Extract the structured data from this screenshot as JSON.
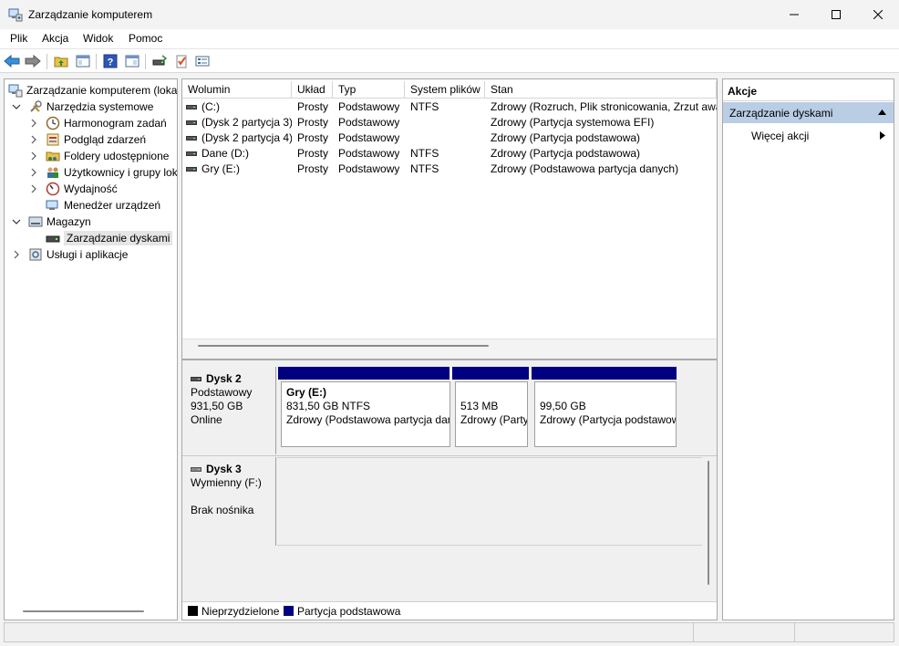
{
  "window": {
    "title": "Zarządzanie komputerem"
  },
  "menu": [
    {
      "label": "Plik"
    },
    {
      "label": "Akcja"
    },
    {
      "label": "Widok"
    },
    {
      "label": "Pomoc"
    }
  ],
  "tree": {
    "root": "Zarządzanie komputerem (lokalny)",
    "system_tools": "Narzędzia systemowe",
    "task_scheduler": "Harmonogram zadań",
    "event_viewer": "Podgląd zdarzeń",
    "shared_folders": "Foldery udostępnione",
    "users_groups": "Użytkownicy i grupy lokalne",
    "performance": "Wydajność",
    "device_manager": "Menedżer urządzeń",
    "storage": "Magazyn",
    "disk_management": "Zarządzanie dyskami",
    "services_apps": "Usługi i aplikacje"
  },
  "volumes": {
    "columns": [
      "Wolumin",
      "Układ",
      "Typ",
      "System plików",
      "Stan"
    ],
    "rows": [
      {
        "volume": "(C:)",
        "layout": "Prosty",
        "type": "Podstawowy",
        "fs": "NTFS",
        "status": "Zdrowy (Rozruch, Plik stronicowania, Zrzut awaryjny, Partycja podstawowa)"
      },
      {
        "volume": "(Dysk 2 partycja 3)",
        "layout": "Prosty",
        "type": "Podstawowy",
        "fs": "",
        "status": "Zdrowy (Partycja systemowa EFI)"
      },
      {
        "volume": "(Dysk 2 partycja 4)",
        "layout": "Prosty",
        "type": "Podstawowy",
        "fs": "",
        "status": "Zdrowy (Partycja podstawowa)"
      },
      {
        "volume": "Dane (D:)",
        "layout": "Prosty",
        "type": "Podstawowy",
        "fs": "NTFS",
        "status": "Zdrowy (Partycja podstawowa)"
      },
      {
        "volume": "Gry (E:)",
        "layout": "Prosty",
        "type": "Podstawowy",
        "fs": "NTFS",
        "status": "Zdrowy (Podstawowa partycja danych)"
      }
    ]
  },
  "disks": {
    "disk2": {
      "name": "Dysk 2",
      "type": "Podstawowy",
      "size": "931,50 GB",
      "state": "Online",
      "partitions": [
        {
          "name": "Gry  (E:)",
          "size": "831,50 GB NTFS",
          "status": "Zdrowy (Podstawowa partycja danych)"
        },
        {
          "name": "",
          "size": "513 MB",
          "status": "Zdrowy (Partycja systemowa EFI)"
        },
        {
          "name": "",
          "size": "99,50 GB",
          "status": "Zdrowy (Partycja podstawowa)"
        }
      ]
    },
    "disk3": {
      "name": "Dysk 3",
      "type": "Wymienny (F:)",
      "state": "Brak nośnika"
    }
  },
  "legend": {
    "unallocated": "Nieprzydzielone",
    "primary": "Partycja podstawowa",
    "unallocated_color": "#000000",
    "primary_color": "#000080"
  },
  "actions": {
    "header": "Akcje",
    "section": "Zarządzanie dyskami",
    "more": "Więcej akcji"
  }
}
